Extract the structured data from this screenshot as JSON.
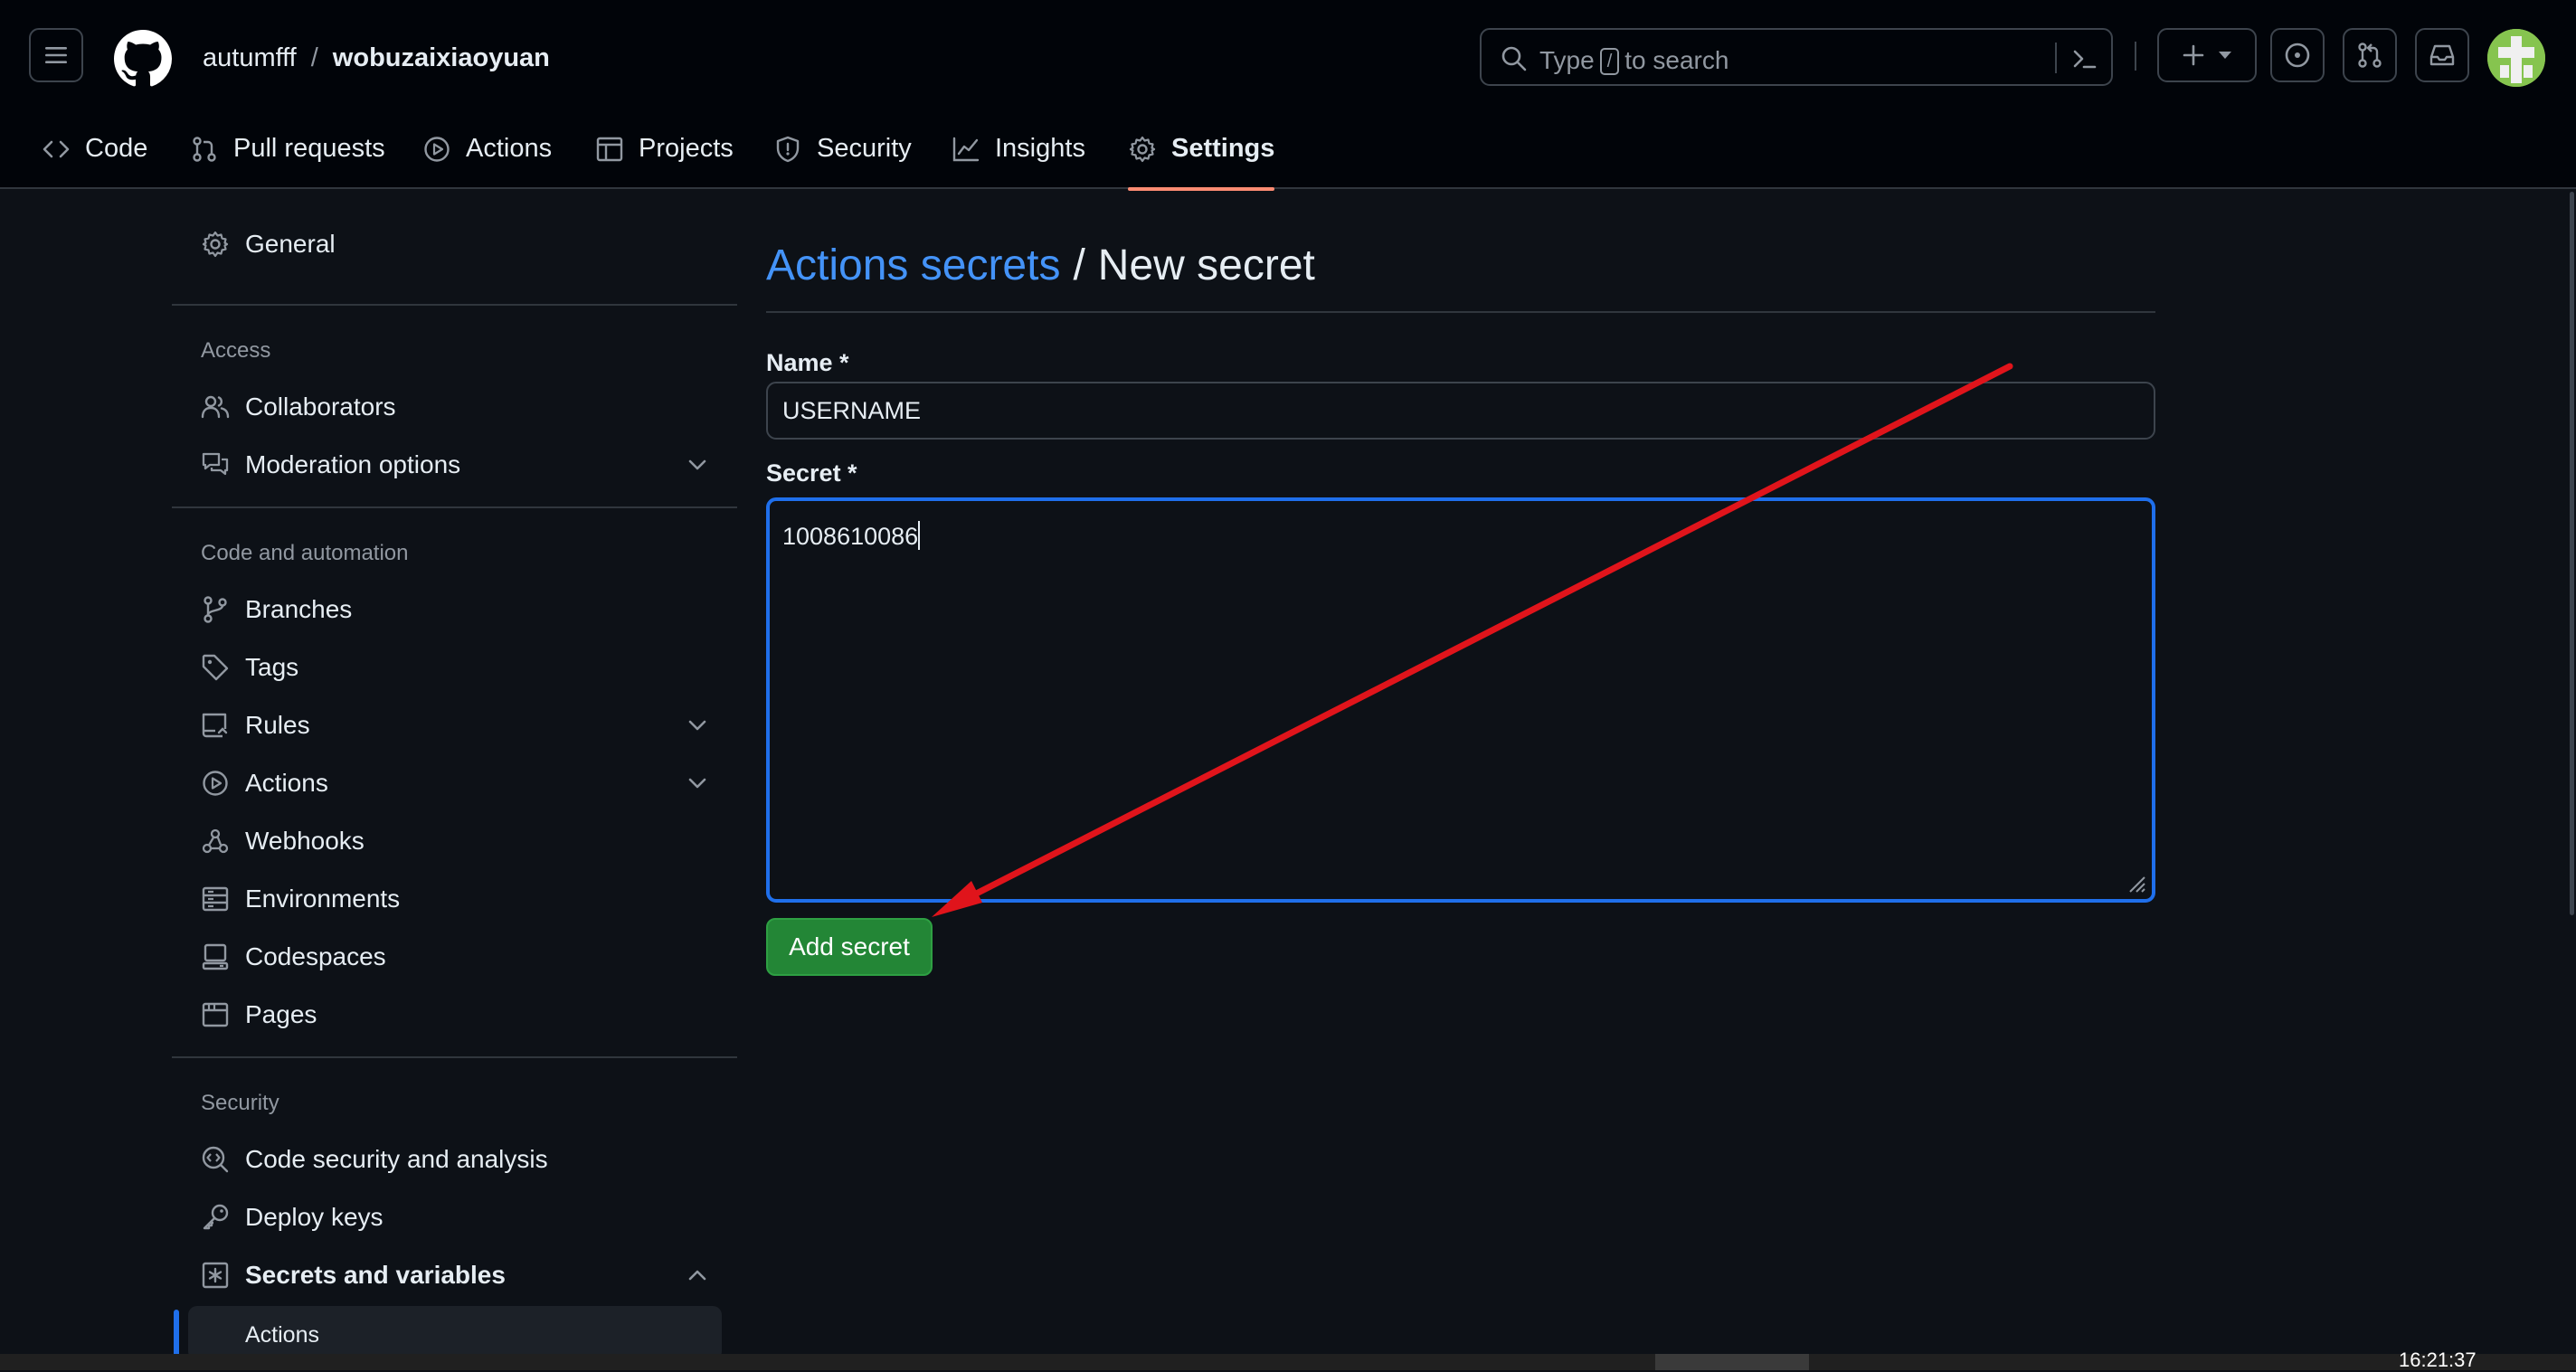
{
  "header": {
    "owner": "autumfff",
    "separator": "/",
    "repo": "wobuzaixiaoyuan",
    "search": {
      "prefix": "Type",
      "key": "/",
      "suffix": "to search"
    }
  },
  "nav": {
    "tabs": [
      {
        "label": "Code",
        "icon": "code-icon"
      },
      {
        "label": "Pull requests",
        "icon": "git-pull-request-icon"
      },
      {
        "label": "Actions",
        "icon": "play-circle-icon"
      },
      {
        "label": "Projects",
        "icon": "table-icon"
      },
      {
        "label": "Security",
        "icon": "shield-icon"
      },
      {
        "label": "Insights",
        "icon": "graph-icon"
      },
      {
        "label": "Settings",
        "icon": "gear-icon",
        "active": true
      }
    ]
  },
  "sidebar": {
    "general": "General",
    "access_heading": "Access",
    "collaborators": "Collaborators",
    "moderation": "Moderation options",
    "code_heading": "Code and automation",
    "branches": "Branches",
    "tags": "Tags",
    "rules": "Rules",
    "actions": "Actions",
    "webhooks": "Webhooks",
    "environments": "Environments",
    "codespaces": "Codespaces",
    "pages": "Pages",
    "security_heading": "Security",
    "code_security": "Code security and analysis",
    "deploy_keys": "Deploy keys",
    "secrets": "Secrets and variables",
    "secrets_actions": "Actions"
  },
  "main": {
    "breadcrumb_link": "Actions secrets",
    "breadcrumb_sep": "/",
    "breadcrumb_current": "New secret",
    "name_label": "Name *",
    "name_value": "USERNAME",
    "secret_label": "Secret *",
    "secret_value": "1008610086",
    "submit_label": "Add secret"
  },
  "taskbar": {
    "clock": "16:21:37"
  },
  "colors": {
    "background": "#0d1117",
    "header": "#010409",
    "link": "#4493f8",
    "primary_button": "#238636",
    "focus_border": "#1f6feb",
    "active_tab_underline": "#fd8c73",
    "annotation_arrow": "#e0141b"
  }
}
